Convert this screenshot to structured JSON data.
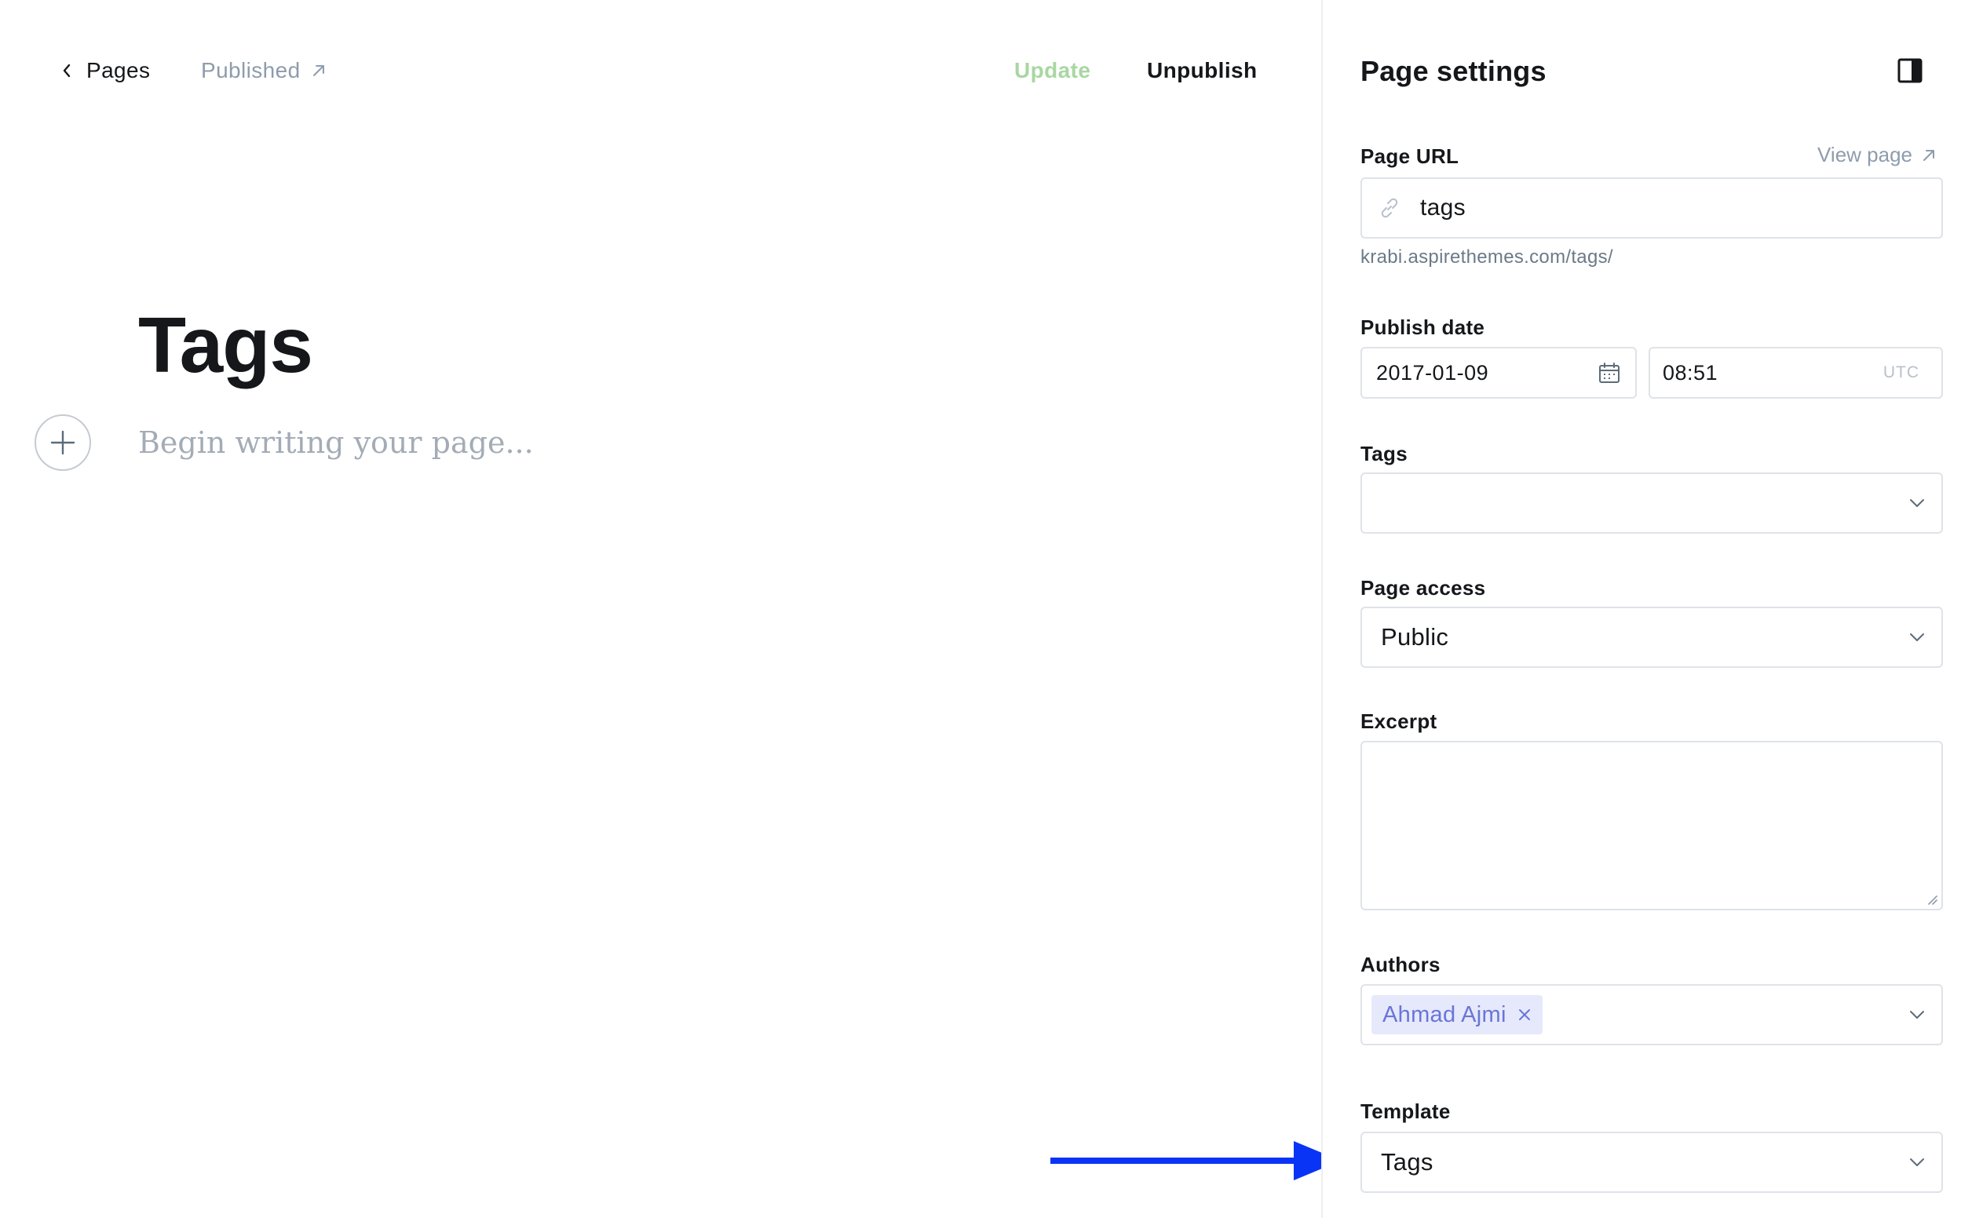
{
  "editor": {
    "back_label": "Pages",
    "status_label": "Published",
    "update_label": "Update",
    "unpublish_label": "Unpublish",
    "title": "Tags",
    "placeholder": "Begin writing your page..."
  },
  "settings": {
    "title": "Page settings",
    "page_url": {
      "label": "Page URL",
      "view_link": "View page",
      "value": "tags",
      "hint": "krabi.aspirethemes.com/tags/"
    },
    "publish_date": {
      "label": "Publish date",
      "date": "2017-01-09",
      "time": "08:51",
      "timezone": "UTC"
    },
    "tags": {
      "label": "Tags",
      "value": ""
    },
    "page_access": {
      "label": "Page access",
      "value": "Public"
    },
    "excerpt": {
      "label": "Excerpt",
      "value": ""
    },
    "authors": {
      "label": "Authors",
      "items": [
        "Ahmad Ajmi"
      ]
    },
    "template": {
      "label": "Template",
      "value": "Tags"
    }
  },
  "colors": {
    "update_accent": "#a8d7a1",
    "author_token_bg": "#e6e9fb",
    "author_token_text": "#6a75d8",
    "annotation_arrow": "#0a34f5"
  },
  "icons": [
    "chevron-left-icon",
    "arrow-up-right-icon",
    "plus-icon",
    "sidebar-toggle-icon",
    "link-icon",
    "calendar-icon",
    "chevron-down-icon",
    "close-icon",
    "annotation-arrow-icon"
  ]
}
